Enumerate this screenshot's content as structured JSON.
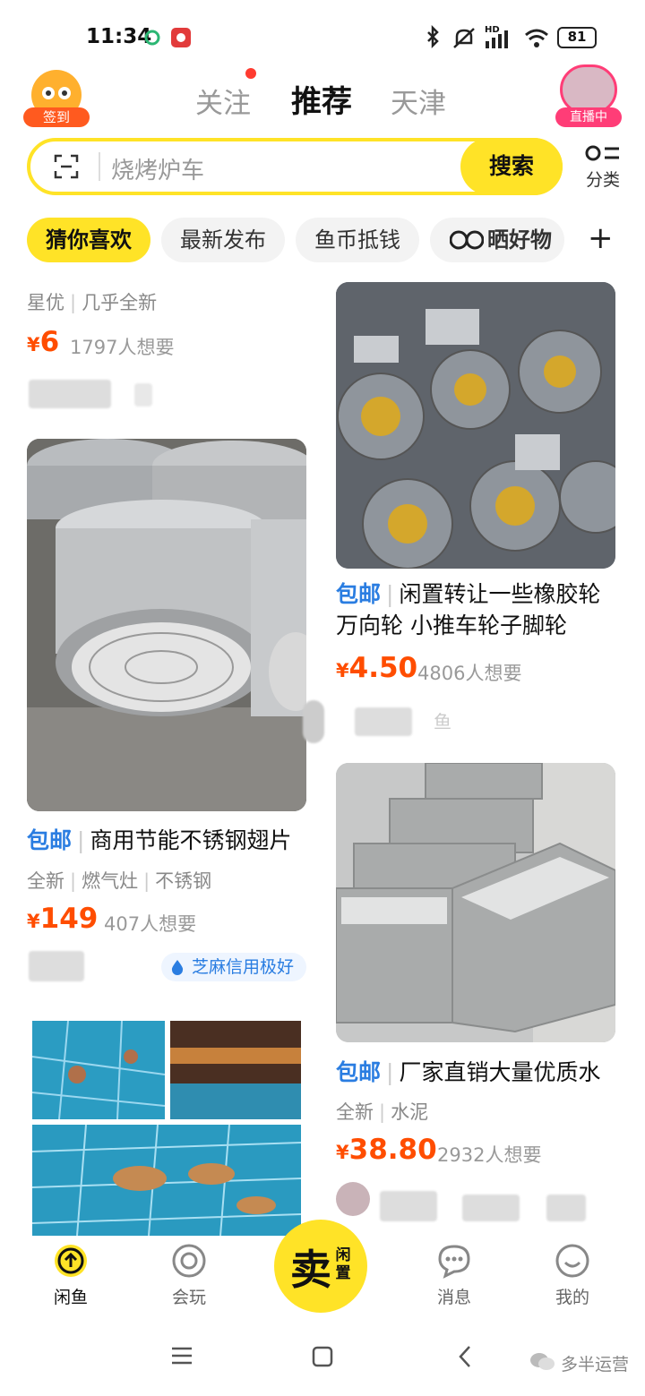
{
  "status_bar": {
    "time": "11:34",
    "battery": "81",
    "network": "HD"
  },
  "header": {
    "signin_label": "签到",
    "tabs": [
      {
        "label": "关注",
        "badge": true
      },
      {
        "label": "推荐",
        "active": true
      },
      {
        "label": "天津"
      }
    ],
    "live_label": "直播中"
  },
  "search": {
    "placeholder": "烧烤炉车",
    "button": "搜索",
    "category_label": "分类"
  },
  "chips": [
    {
      "label": "猜你喜欢",
      "active": true
    },
    {
      "label": "最新发布"
    },
    {
      "label": "鱼币抵钱"
    },
    {
      "label": "晒好物"
    }
  ],
  "chips_more": "+",
  "feed": {
    "left": [
      {
        "meta": [
          "星优",
          "几乎全新"
        ],
        "currency": "¥",
        "price": "6",
        "want": "1797人想要"
      },
      {
        "tag": "包邮",
        "title": "商用节能不锈钢翅片",
        "meta": [
          "全新",
          "燃气灶",
          "不锈钢"
        ],
        "currency": "¥",
        "price": "149",
        "want": "407人想要",
        "credit": "芝麻信用极好"
      }
    ],
    "right": [
      {
        "tag": "包邮",
        "title": "闲置转让一些橡胶轮万向轮 小推车轮子脚轮",
        "currency": "¥",
        "price": "4.50",
        "want": "4806人想要",
        "seller": "鱼"
      },
      {
        "tag": "包邮",
        "title": "厂家直销大量优质水",
        "meta": [
          "全新",
          "水泥"
        ],
        "currency": "¥",
        "price": "38.80",
        "want": "2932人想要"
      }
    ]
  },
  "bottom_nav": [
    {
      "label": "闲鱼",
      "icon": "arrow-up-circle-icon",
      "active": true
    },
    {
      "label": "会玩",
      "icon": "target-icon"
    },
    {
      "label": "消息",
      "icon": "chat-bubble-icon"
    },
    {
      "label": "我的",
      "icon": "smile-icon"
    }
  ],
  "sell_button": {
    "main": "卖",
    "sub": "闲置"
  },
  "watermark": "多半运营",
  "colors": {
    "brand_yellow": "#ffe327",
    "price_orange": "#ff4d00",
    "tag_blue": "#2a7de1"
  }
}
